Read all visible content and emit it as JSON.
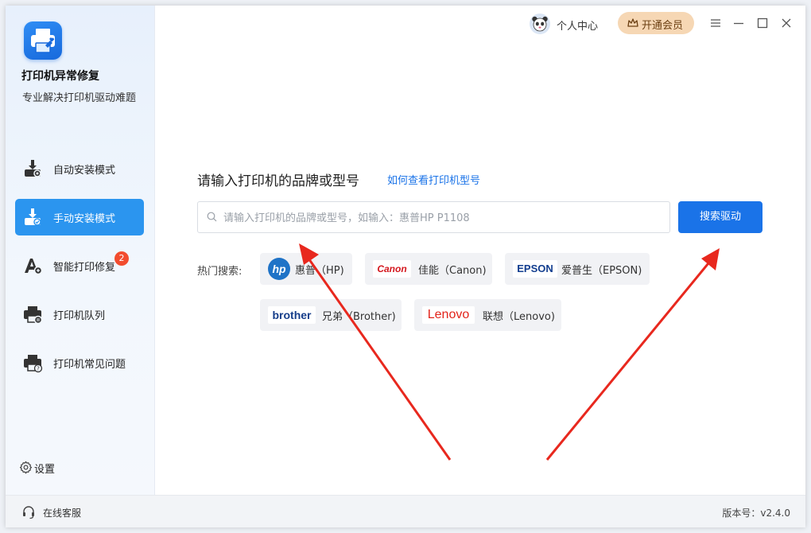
{
  "app": {
    "name": "打印机异常修复",
    "subtitle": "专业解决打印机驱动难题"
  },
  "sidebar": {
    "items": [
      {
        "label": "自动安装模式"
      },
      {
        "label": "手动安装模式",
        "active": true
      },
      {
        "label": "智能打印修复",
        "badge": "2"
      },
      {
        "label": "打印机队列"
      },
      {
        "label": "打印机常见问题"
      }
    ],
    "settings_label": "设置"
  },
  "topbar": {
    "user_label": "个人中心",
    "vip_label": "开通会员"
  },
  "main": {
    "prompt_title": "请输入打印机的品牌或型号",
    "help_link": "如何查看打印机型号",
    "search_placeholder": "请输入打印机的品牌或型号，如输入：惠普HP P1108",
    "search_button": "搜索驱动",
    "hot_label": "热门搜索:",
    "brands": [
      {
        "logo": "hp",
        "name": "惠普（HP)"
      },
      {
        "logo": "Canon",
        "name": "佳能（Canon)"
      },
      {
        "logo": "EPSON",
        "name": "爱普生（EPSON)"
      },
      {
        "logo": "brother",
        "name": "兄弟（Brother)"
      },
      {
        "logo": "Lenovo",
        "name": "联想（Lenovo)"
      }
    ]
  },
  "footer": {
    "service_label": "在线客服",
    "version": "版本号：v2.4.0"
  },
  "colors": {
    "accent": "#1a73e8",
    "active_nav": "#2b95ef",
    "badge": "#f24c2e",
    "vip_bg": "#f6d7b4",
    "annotation_arrow": "#e8281e"
  }
}
